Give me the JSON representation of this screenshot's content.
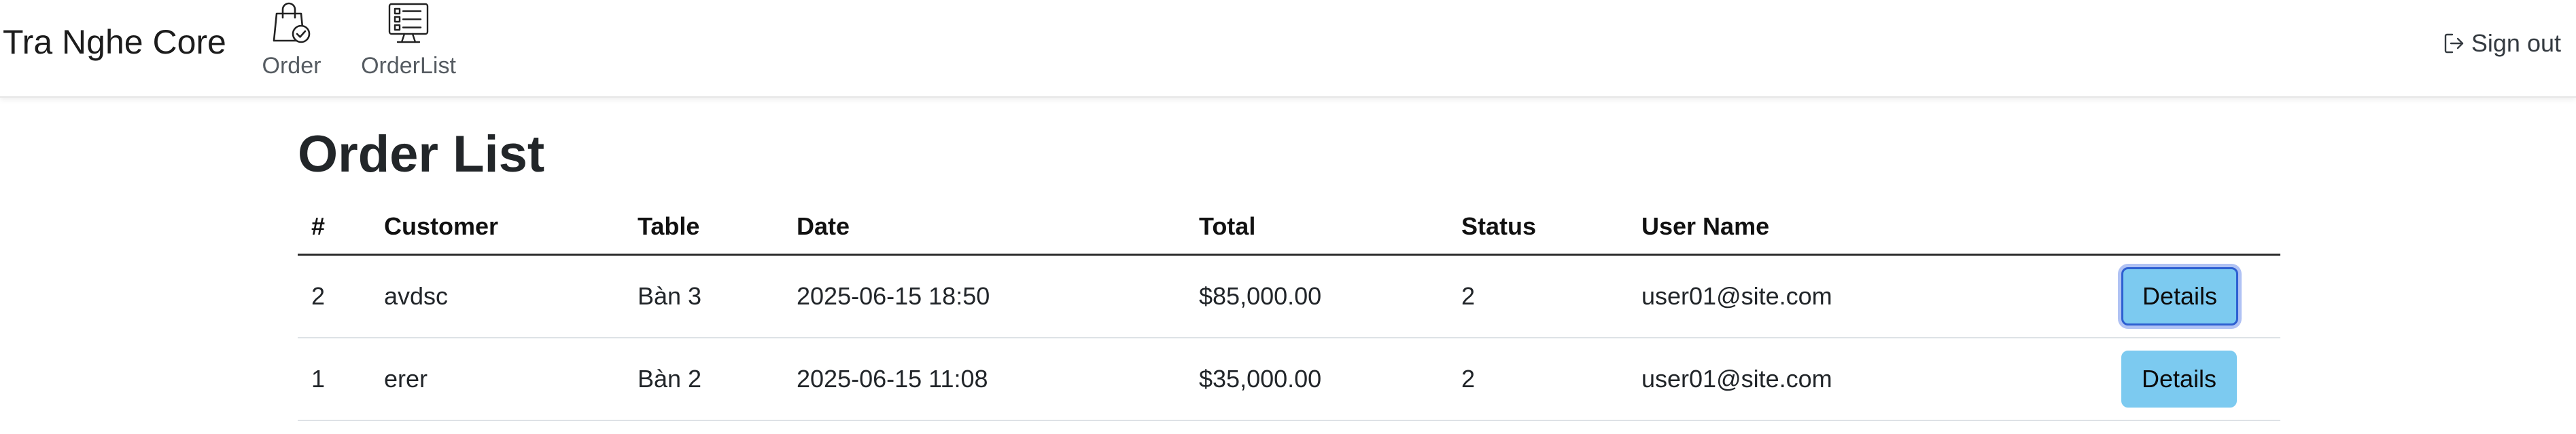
{
  "navbar": {
    "brand": "Tra Nghe Core",
    "items": [
      {
        "label": "Order",
        "icon": "shopping-bag-check-icon"
      },
      {
        "label": "OrderList",
        "icon": "order-list-icon"
      }
    ],
    "signout_label": "Sign out",
    "signout_icon": "sign-out-icon"
  },
  "page": {
    "title": "Order List"
  },
  "table": {
    "headers": [
      "#",
      "Customer",
      "Table",
      "Date",
      "Total",
      "Status",
      "User Name",
      ""
    ],
    "rows": [
      {
        "num": "2",
        "customer": "avdsc",
        "table": "Bàn 3",
        "date": "2025-06-15 18:50",
        "total": "$85,000.00",
        "status": "2",
        "user": "user01@site.com",
        "action": "Details",
        "focused": true
      },
      {
        "num": "1",
        "customer": "erer",
        "table": "Bàn 2",
        "date": "2025-06-15 11:08",
        "total": "$35,000.00",
        "status": "2",
        "user": "user01@site.com",
        "action": "Details",
        "focused": false
      }
    ]
  },
  "colors": {
    "button_bg": "#7ccaf0",
    "focus_ring": "#2d5fd1",
    "text": "#212529"
  }
}
